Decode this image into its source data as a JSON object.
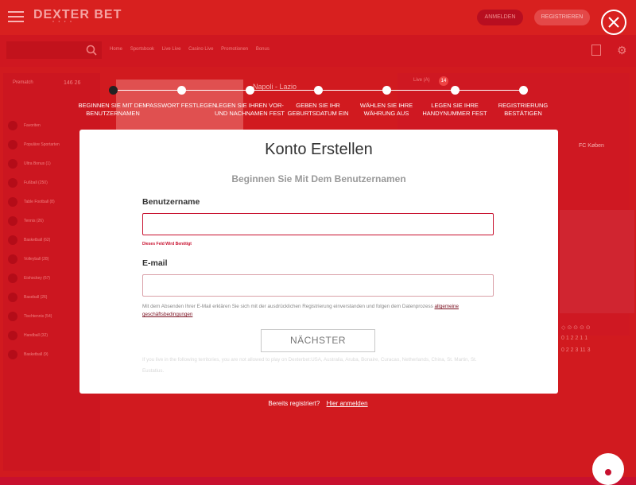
{
  "header": {
    "logo_text": "DEXTER BET",
    "logo_sub": "* * * *",
    "login_label": "ANMELDEN",
    "register_label": "REGISTRIEREN"
  },
  "background_nav": [
    "Home",
    "Sportsbook",
    "Live Live",
    "Casino Live",
    "Promotionen",
    "Bonus"
  ],
  "background_sidebar": {
    "header": "Prematch",
    "count": "146  26",
    "items": [
      "Favoriten",
      "Populäre Sportarten",
      "Ultra Bonus (1)",
      "Fußball (250)",
      "Table Football (8)",
      "Tennis (26)",
      "Basketball (62)",
      "Volleyball (28)",
      "Eishockey (67)",
      "Baseball (26)",
      "Tischtennis (54)",
      "Handball (32)",
      "Basketball (9)"
    ]
  },
  "background_match": {
    "title": "Napoli - Lazio",
    "live_tab": "Live (A)",
    "live_badge": "14",
    "team_right": "FC Køben",
    "stats_row1": "◇  ⊙  ⊙  ⊙  ⊙",
    "stats_row2": "0    1    2    2    1    1",
    "stats_row3": "0    2    2    3   11    3"
  },
  "stepper": {
    "steps": [
      "Beginnen Sie mit dem Benutzernamen",
      "Passwort festlegen",
      "Legen Sie Ihren Vor- und Nachnamen fest",
      "Geben Sie Ihr Geburtsdatum ein",
      "Wählen Sie Ihre Währung aus",
      "Legen Sie Ihre Handynummer fest",
      "Registrierung bestätigen"
    ]
  },
  "modal": {
    "title": "Konto Erstellen",
    "subtitle": "Beginnen Sie Mit Dem Benutzernamen",
    "username_label": "Benutzername",
    "username_value": "",
    "username_error": "Dieses Feld Wird Benötigt",
    "email_label": "E-mail",
    "email_value": "",
    "consent_text": "Mit dem Absenden Ihrer E-Mail erklären Sie sich mit der ausdrücklichen Registrierung einverstanden und folgen dem Datenprozess",
    "consent_link": "allgemeine geschäftsbedingungen",
    "next_label": "NÄCHSTER",
    "restriction_text": "If you live in the following territories, you are not allowed to play on Dexterbet:USA, Australia, Aruba, Bonaire, Curacao, Netherlands, China, St. Martin, St. Eustatius."
  },
  "footer_login": {
    "prompt": "Bereits registriert?",
    "link": "Hier anmelden"
  },
  "colors": {
    "brand_red": "#c8102e",
    "modal_bg": "#ffffff",
    "error": "#c8102e"
  }
}
